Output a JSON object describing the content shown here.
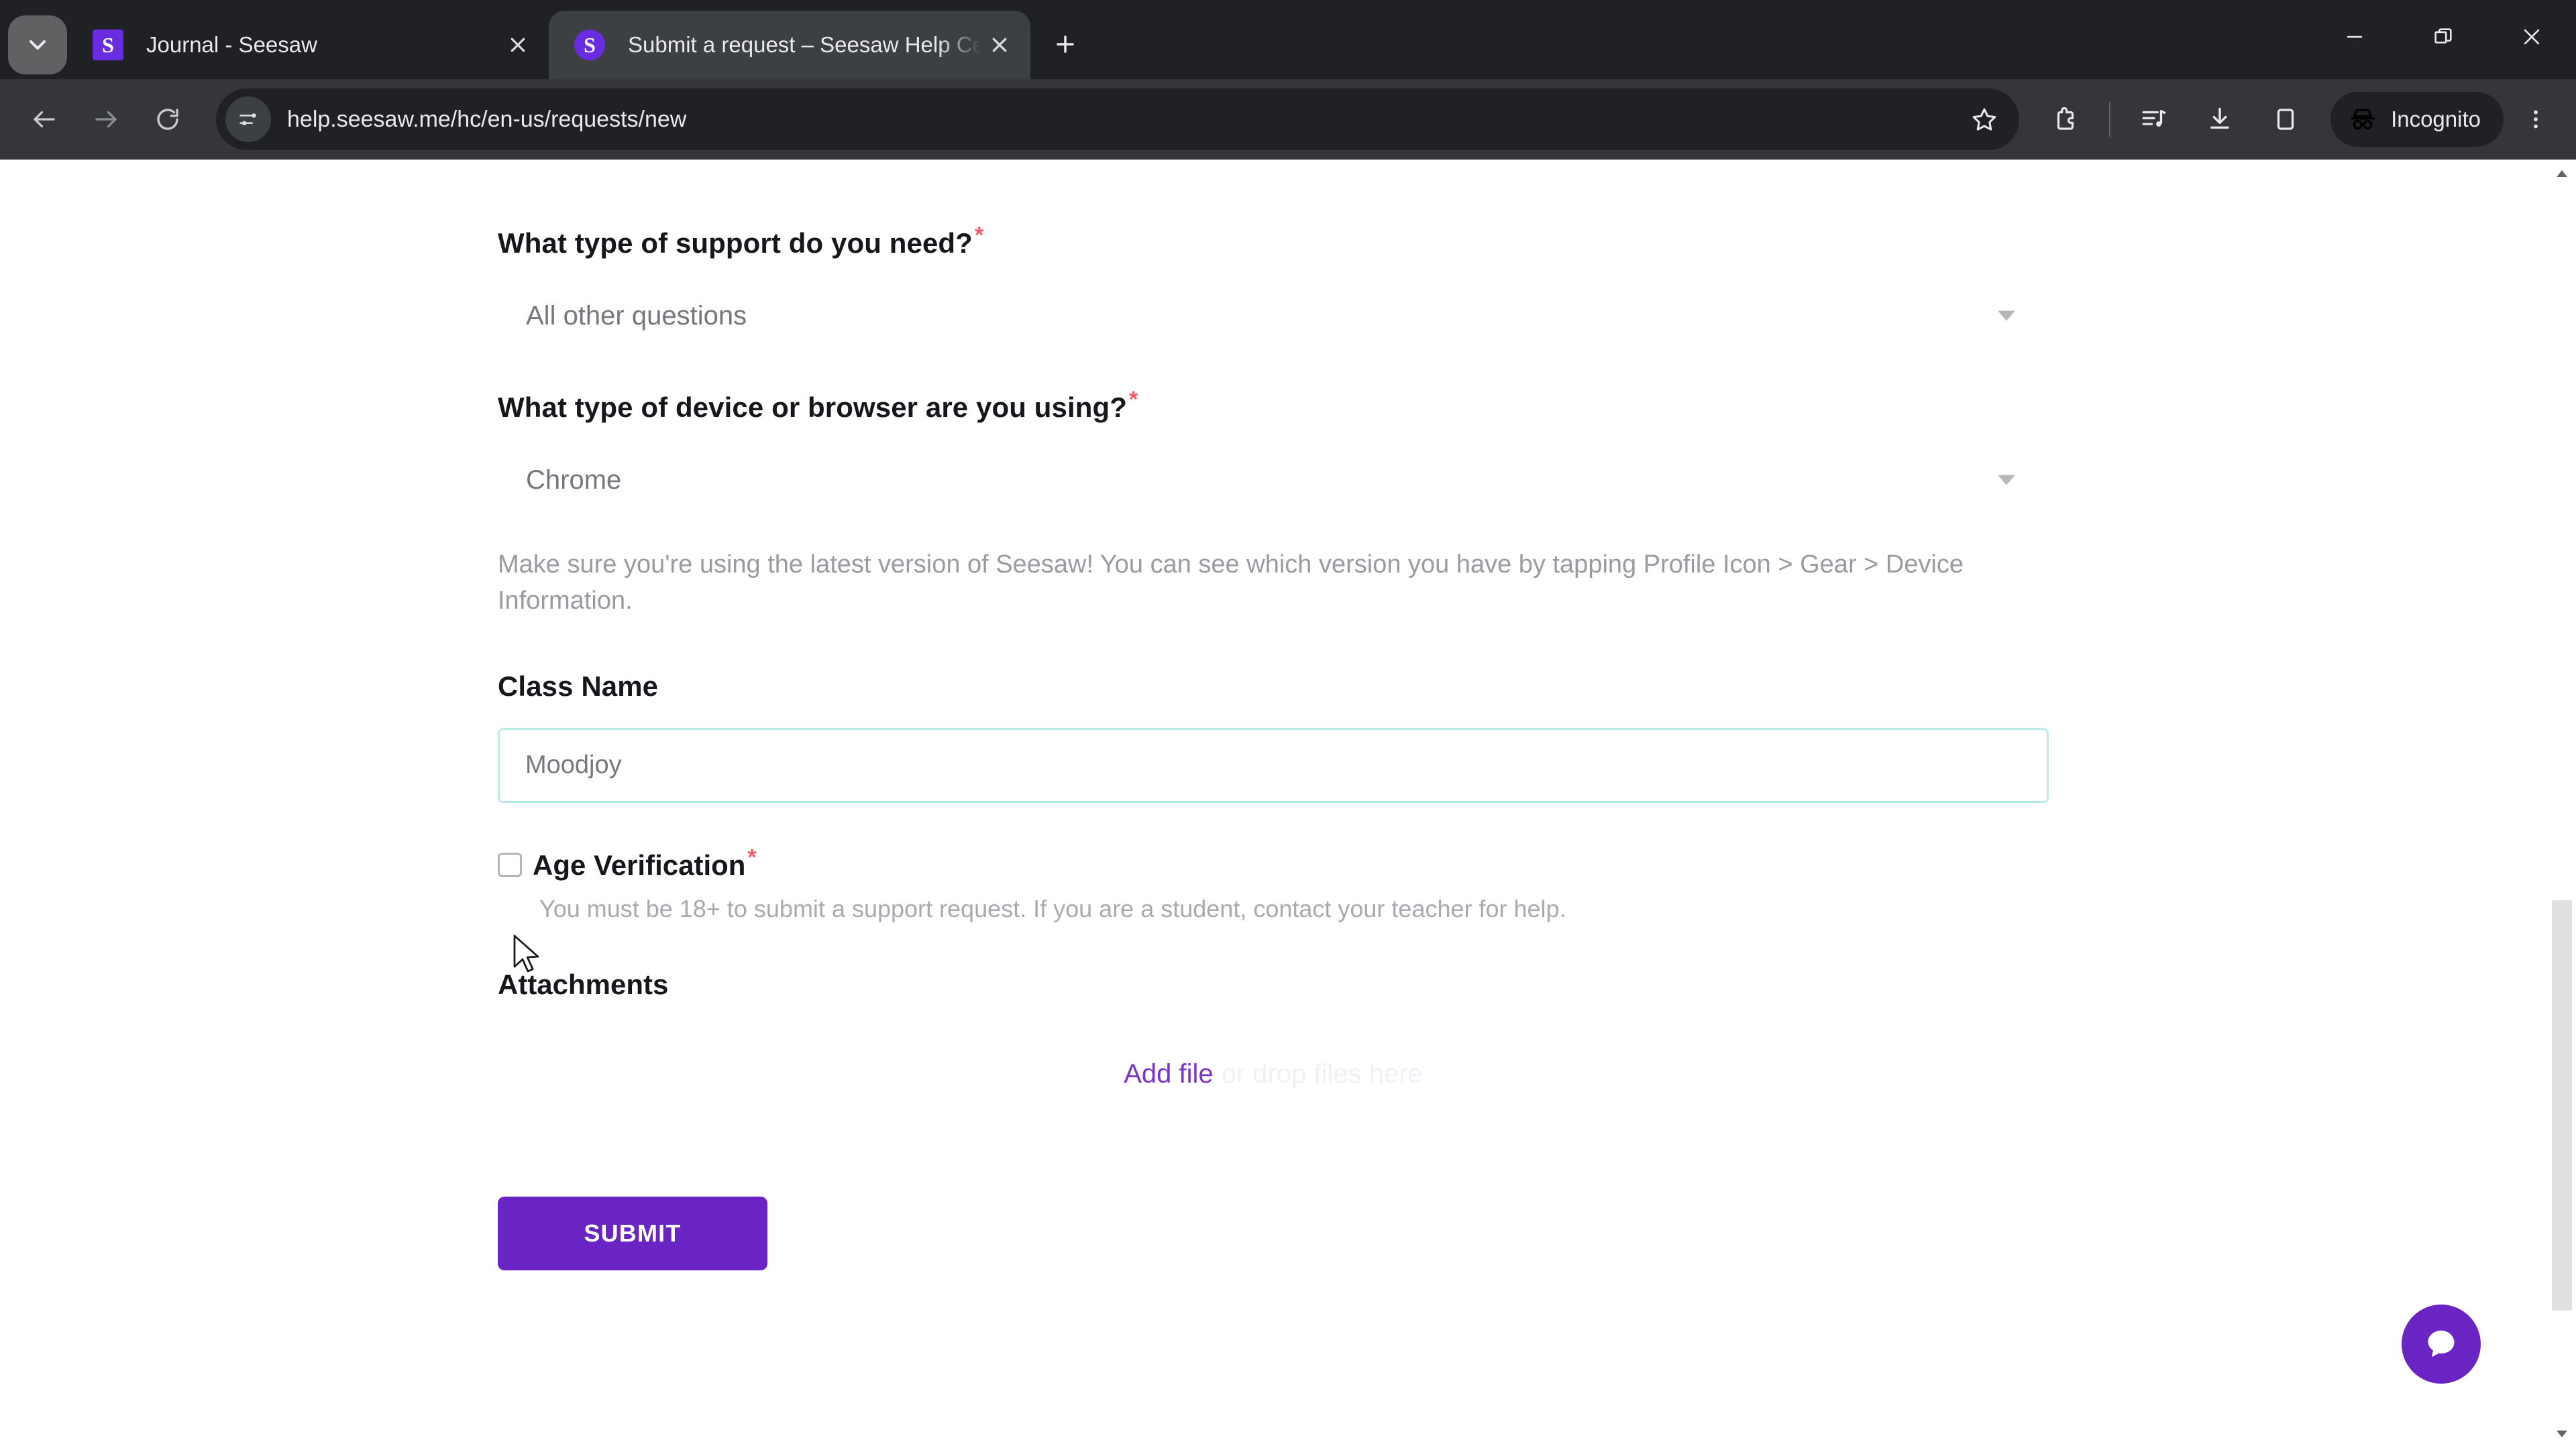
{
  "browser": {
    "tabs": [
      {
        "title": "Journal - Seesaw",
        "favicon_letter": "S",
        "active": false
      },
      {
        "title": "Submit a request – Seesaw Help Center",
        "favicon_letter": "S",
        "active": true
      }
    ],
    "new_tab_label": "+",
    "window_controls": {
      "minimize": "minimize-icon",
      "restore": "restore-icon",
      "close": "close-icon"
    },
    "toolbar": {
      "back": "back-arrow-icon",
      "forward": "forward-arrow-icon",
      "reload": "reload-icon",
      "site_info": "site-settings-icon",
      "url": "help.seesaw.me/hc/en-us/requests/new",
      "bookmark": "star-icon",
      "extensions": "extensions-icon",
      "media": "media-playlist-icon",
      "downloads": "download-icon",
      "side_panel": "side-panel-icon",
      "profile_label": "Incognito",
      "profile_icon": "incognito-icon",
      "menu": "three-dot-menu-icon"
    }
  },
  "form": {
    "support_type": {
      "label": "What type of support do you need?",
      "required_marker": "*",
      "value": "All other questions"
    },
    "device_browser": {
      "label": "What type of device or browser are you using?",
      "required_marker": "*",
      "value": "Chrome",
      "help_text": "Make sure you're using the latest version of Seesaw! You can see which version you have by tapping Profile Icon > Gear > Device Information."
    },
    "class_name": {
      "label": "Class Name",
      "value": "Moodjoy",
      "placeholder": ""
    },
    "age_verification": {
      "label": "Age Verification",
      "required_marker": "*",
      "checked": false,
      "description": "You must be 18+ to submit a support request. If you are a student, contact your teacher for help."
    },
    "attachments": {
      "label": "Attachments",
      "add_file_label": "Add file",
      "drop_hint": "or drop files here"
    },
    "submit_label": "SUBMIT"
  },
  "widgets": {
    "chat_button": "chat-bubble-icon"
  },
  "colors": {
    "brand_purple": "#6b24c4",
    "link_purple": "#7c32cf",
    "required_red": "#f45b69",
    "input_border": "#b9ece9",
    "chrome_dark": "#202124",
    "toolbar_dark": "#35363a"
  }
}
